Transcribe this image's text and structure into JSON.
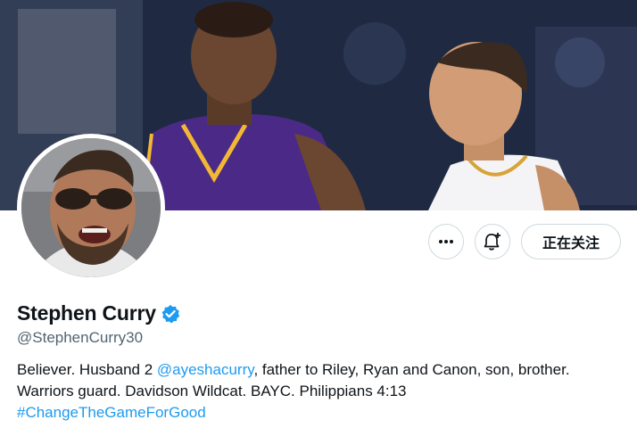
{
  "profile": {
    "display_name": "Stephen Curry",
    "handle": "@StephenCurry30",
    "verified_icon": "verified-badge-icon",
    "bio": {
      "part1": "Believer. Husband 2 ",
      "mention": "@ayeshacurry",
      "part2": ", father to Riley, Ryan and Canon, son, brother.",
      "line2": "Warriors guard. Davidson Wildcat. BAYC. Philippians 4:13",
      "hashtag": "#ChangeTheGameForGood"
    }
  },
  "actions": {
    "more_icon": "more-horizontal-icon",
    "notify_icon": "bell-plus-icon",
    "follow_label": "正在关注"
  },
  "colors": {
    "link": "#1d9bf0",
    "verified": "#1d9bf0",
    "secondary_text": "#536471",
    "button_border": "#cfd9de"
  }
}
